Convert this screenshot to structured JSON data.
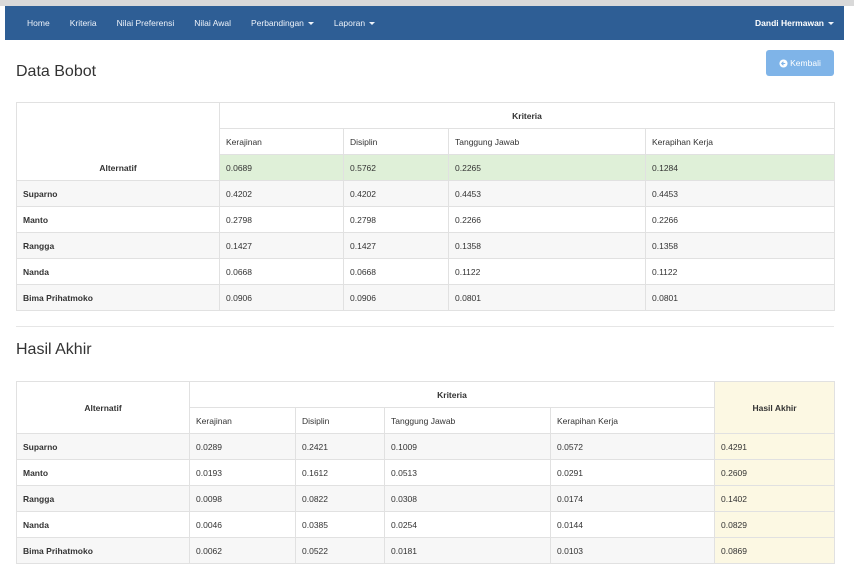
{
  "navbar": {
    "items": [
      {
        "label": "Home",
        "dropdown": false
      },
      {
        "label": "Kriteria",
        "dropdown": false
      },
      {
        "label": "Nilai Preferensi",
        "dropdown": false
      },
      {
        "label": "Nilai Awal",
        "dropdown": false
      },
      {
        "label": "Perbandingan",
        "dropdown": true
      },
      {
        "label": "Laporan",
        "dropdown": true
      }
    ],
    "user": "Dandi Hermawan"
  },
  "bobot": {
    "title": "Data Bobot",
    "back_label": "Kembali",
    "kriteria_header": "Kriteria",
    "alternatif_header": "Alternatif",
    "columns": [
      "Kerajinan",
      "Disiplin",
      "Tanggung Jawab",
      "Kerapihan Kerja"
    ],
    "weights": [
      "0.0689",
      "0.5762",
      "0.2265",
      "0.1284"
    ],
    "rows": [
      {
        "name": "Suparno",
        "values": [
          "0.4202",
          "0.4202",
          "0.4453",
          "0.4453"
        ]
      },
      {
        "name": "Manto",
        "values": [
          "0.2798",
          "0.2798",
          "0.2266",
          "0.2266"
        ]
      },
      {
        "name": "Rangga",
        "values": [
          "0.1427",
          "0.1427",
          "0.1358",
          "0.1358"
        ]
      },
      {
        "name": "Nanda",
        "values": [
          "0.0668",
          "0.0668",
          "0.1122",
          "0.1122"
        ]
      },
      {
        "name": "Bima Prihatmoko",
        "values": [
          "0.0906",
          "0.0906",
          "0.0801",
          "0.0801"
        ]
      }
    ]
  },
  "hasil": {
    "title": "Hasil Akhir",
    "kriteria_header": "Kriteria",
    "alternatif_header": "Alternatif",
    "result_header": "Hasil Akhir",
    "columns": [
      "Kerajinan",
      "Disiplin",
      "Tanggung Jawab",
      "Kerapihan Kerja"
    ],
    "rows": [
      {
        "name": "Suparno",
        "values": [
          "0.0289",
          "0.2421",
          "0.1009",
          "0.0572"
        ],
        "result": "0.4291"
      },
      {
        "name": "Manto",
        "values": [
          "0.0193",
          "0.1612",
          "0.0513",
          "0.0291"
        ],
        "result": "0.2609"
      },
      {
        "name": "Rangga",
        "values": [
          "0.0098",
          "0.0822",
          "0.0308",
          "0.0174"
        ],
        "result": "0.1402"
      },
      {
        "name": "Nanda",
        "values": [
          "0.0046",
          "0.0385",
          "0.0254",
          "0.0144"
        ],
        "result": "0.0829"
      },
      {
        "name": "Bima Prihatmoko",
        "values": [
          "0.0062",
          "0.0522",
          "0.0181",
          "0.0103"
        ],
        "result": "0.0869"
      }
    ]
  },
  "colors": {
    "navbar": "#2e5e95",
    "button": "#7fb4e8",
    "weights_row": "#dff0d8",
    "result_column": "#fcf8e3"
  }
}
